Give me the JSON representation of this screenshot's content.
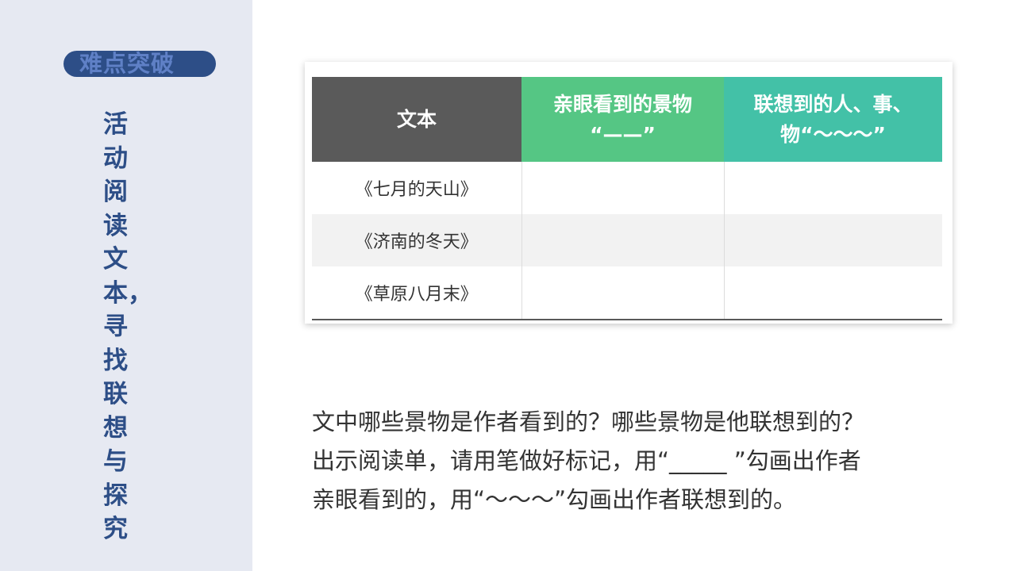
{
  "sidebar": {
    "badge_label": "难点突破",
    "vertical_title_chars": [
      "活",
      "动",
      "阅",
      "读",
      "文",
      "本，",
      "寻",
      "找",
      "联",
      "想",
      "与",
      "探",
      "究"
    ]
  },
  "table": {
    "headers": {
      "text": "文本",
      "seen_line1": "亲眼看到的景物",
      "seen_line2": "“——”",
      "imagined_line1": "联想到的人、事、",
      "imagined_line2": "物“～～～”"
    },
    "rows": [
      {
        "title": "《七月的天山》",
        "seen": "",
        "imagined": ""
      },
      {
        "title": "《济南的冬天》",
        "seen": "",
        "imagined": ""
      },
      {
        "title": "《草原八月末》",
        "seen": "",
        "imagined": ""
      }
    ]
  },
  "paragraph": {
    "line1": "文中哪些景物是作者看到的？哪些景物是他联想到的？",
    "line2": "出示阅读单，请用笔做好标记，用“_____ ”勾画出作者",
    "line3": "亲眼看到的，用“～～～”勾画出作者联想到的。"
  },
  "colors": {
    "sidebar_bg": "#e6e9f2",
    "brand_blue": "#2d4e87",
    "header_gray": "#5a5a5a",
    "header_green": "#55c684",
    "header_teal": "#43c1a7"
  }
}
